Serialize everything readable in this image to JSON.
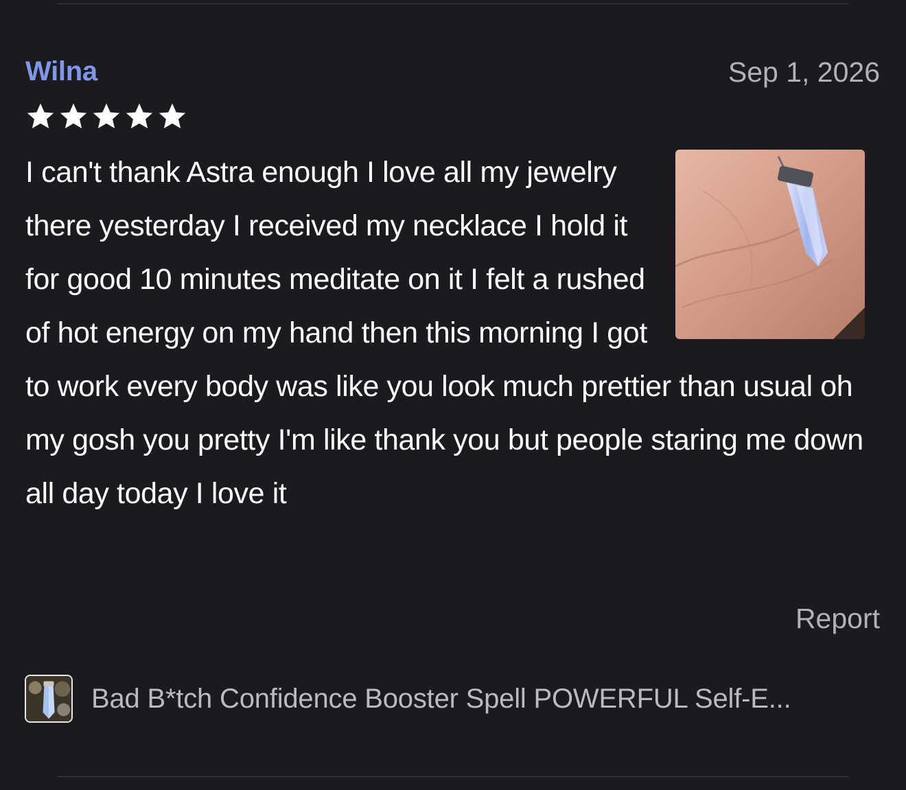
{
  "review": {
    "reviewer_name": "Wilna",
    "date": "Sep 1, 2026",
    "rating": 5,
    "rating_max": 5,
    "text": "I can't thank Astra enough I love all my jewelry there yesterday I received my necklace I hold it for good 10 minutes meditate on it I felt a rushed of hot energy on my hand then this morning I got to work every body was like you look much prettier than usual oh my gosh you pretty I'm like thank you but people staring me down all day today I love it",
    "report_label": "Report"
  },
  "listing": {
    "title": "Bad B*tch Confidence Booster Spell POWERFUL Self-E..."
  },
  "colors": {
    "background": "#1c1a1f",
    "reviewer_name": "#7d98e6",
    "muted_text": "#b3b1b8",
    "star": "#ffffff"
  }
}
